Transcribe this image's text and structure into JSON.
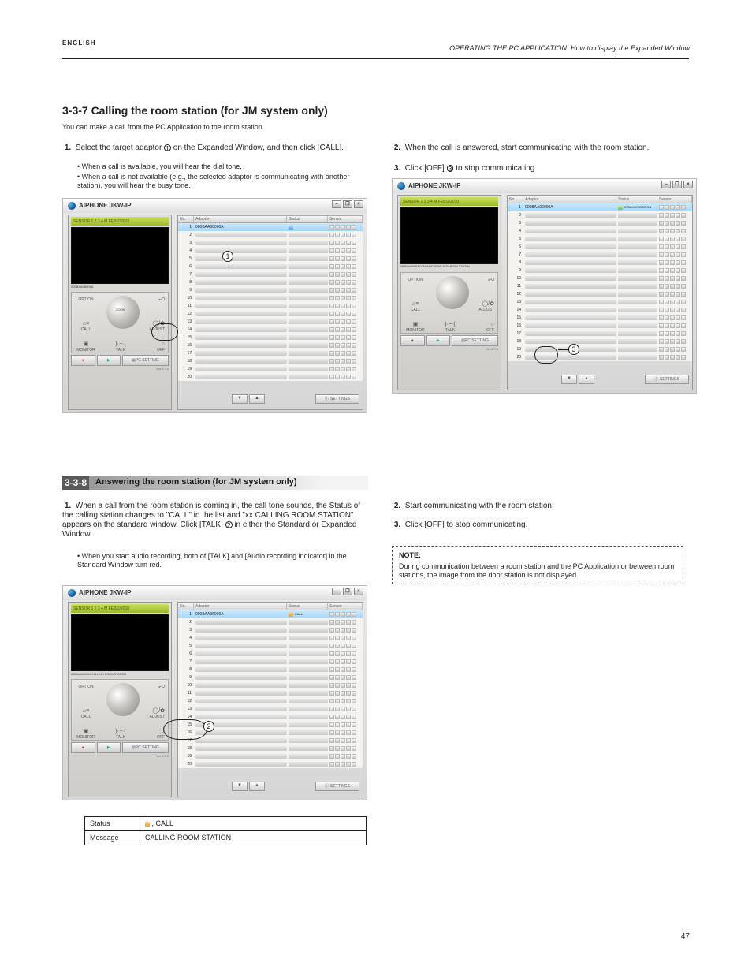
{
  "header": {
    "breadcrumb_label": "OPERATING THE PC APPLICATION",
    "breadcrumb_sub": "How to display the Expanded Window",
    "page_no": "47",
    "english": "ENGLISH"
  },
  "section_3_3_7": {
    "title": "3-3-7  Calling the room station (for JM system only)",
    "intro": "You can make a call from the PC Application to the room station.",
    "step1_no": "1.",
    "step1": "Select the target adaptor ① on the Expanded Window, and then click [CALL].",
    "bullet1": "When a call is available, you will hear the dial tone.",
    "bullet2": "When a call is not available (e.g., the selected adaptor is communicating with another station), you will hear the busy tone.",
    "step2_no": "2.",
    "step2": "When the call is answered, start communicating with the room station.",
    "step3_no": "3.",
    "step3": "Click [OFF] ③ to stop communicating."
  },
  "section_3_3_8": {
    "label_no": "3-3-8",
    "label": "Answering the room station (for JM system only)",
    "step1_no": "1.",
    "step1": "When a call from the room station is coming in, the call tone sounds, the Status of the calling station changes to \"CALL\" in the list and \"xx CALLING ROOM STATION\" appears on the standard window. Click [TALK] ② in either the Standard or Expanded Window.",
    "table": {
      "status_label": "Status",
      "status_val": ", CALL",
      "message_label": "Message",
      "message_val": "CALLING ROOM STATION"
    },
    "step2_no": "2.",
    "step2": "Start communicating with the room station.",
    "step3_no": "3.",
    "step3": "Click [OFF] to stop communicating.",
    "note": "During communication between a room station and the PC Application or between room stations, the image from the door station is not displayed."
  },
  "screenshot": {
    "app_title": "AIPHONE JKW-IP",
    "sensor_bar": "SENSOR   1 2 3 4  M FEB/2/2010",
    "list_headers": {
      "no": "No.",
      "adaptor": "Adaptor",
      "status": "Status",
      "sensor": "Sensor"
    },
    "rows": [
      1,
      2,
      3,
      4,
      5,
      6,
      7,
      8,
      9,
      10,
      11,
      12,
      13,
      14,
      15,
      16,
      17,
      18,
      19,
      20
    ],
    "row1_ad": "000BAA06000A",
    "status_comm": "COMMUNICATION",
    "status_call": "CALL",
    "pc_setting": "PC SETTING",
    "settings": "SETTINGS",
    "version": "Ver.6.7.0",
    "knob": {
      "option": "OPTION",
      "key": "",
      "call": "CALL",
      "adjust": "ADJUST",
      "zoom": "ZOOM",
      "monitor": "MONITOR",
      "talk": "TALK",
      "off": "OFF",
      "door": "",
      "wide": ""
    },
    "msg_calling": "000BAA06000A CALLING ROOM STATION",
    "msg_comm": "000BAA06000A COMMUNICATING WITH ROOM STATION"
  }
}
